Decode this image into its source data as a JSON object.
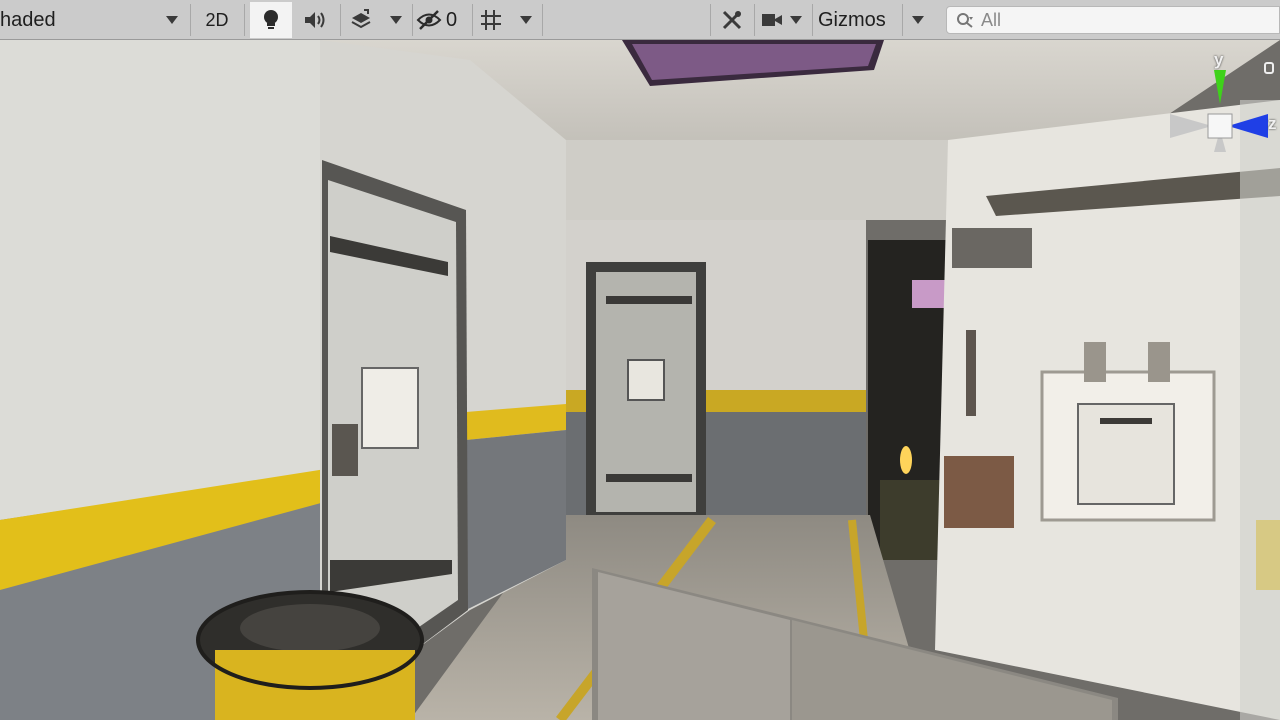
{
  "toolbar": {
    "shading_mode": "haded",
    "mode_2d": "2D",
    "hidden_count": "0",
    "gizmos_label": "Gizmos",
    "search_placeholder": "All"
  },
  "scene": {
    "gizmo_axes": {
      "y": "y",
      "z": "z"
    }
  },
  "colors": {
    "toolbar_bg": "#cbcbcb",
    "active_toggle": "#f3f3f3",
    "yellow_stripe": "#e2bf1a",
    "gizmo_y": "#3ed21a",
    "gizmo_z": "#1f3fe6"
  }
}
